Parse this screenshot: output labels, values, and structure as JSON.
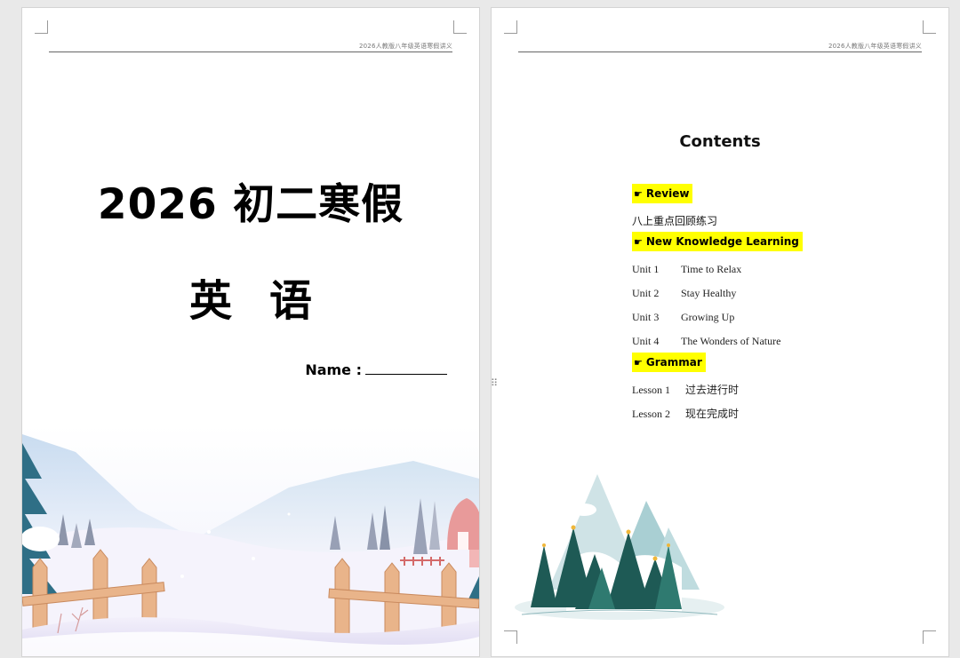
{
  "header": {
    "running_head": "2026人教版八年级英语寒假讲义"
  },
  "cover": {
    "title": "2026 初二寒假",
    "subject": "英语",
    "name_label": "Name :"
  },
  "contents": {
    "title": "Contents",
    "pointer_glyph": "☛",
    "review_heading": "Review",
    "review_item": "八上重点回顾练习",
    "new_heading": "New Knowledge Learning",
    "units": [
      {
        "label": "Unit 1",
        "title": "Time to Relax"
      },
      {
        "label": "Unit 2",
        "title": "Stay Healthy"
      },
      {
        "label": "Unit 3",
        "title": "Growing Up"
      },
      {
        "label": "Unit 4",
        "title": "The Wonders of Nature"
      }
    ],
    "grammar_heading": "Grammar",
    "lessons": [
      {
        "label": "Lesson 1",
        "title": "过去进行时"
      },
      {
        "label": "Lesson 2",
        "title": "现在完成时"
      }
    ]
  },
  "ui": {
    "drag_handle_glyph": "⠿"
  },
  "colors": {
    "highlight": "#ffff00",
    "canvas": "#e9e9e9",
    "page": "#ffffff"
  }
}
